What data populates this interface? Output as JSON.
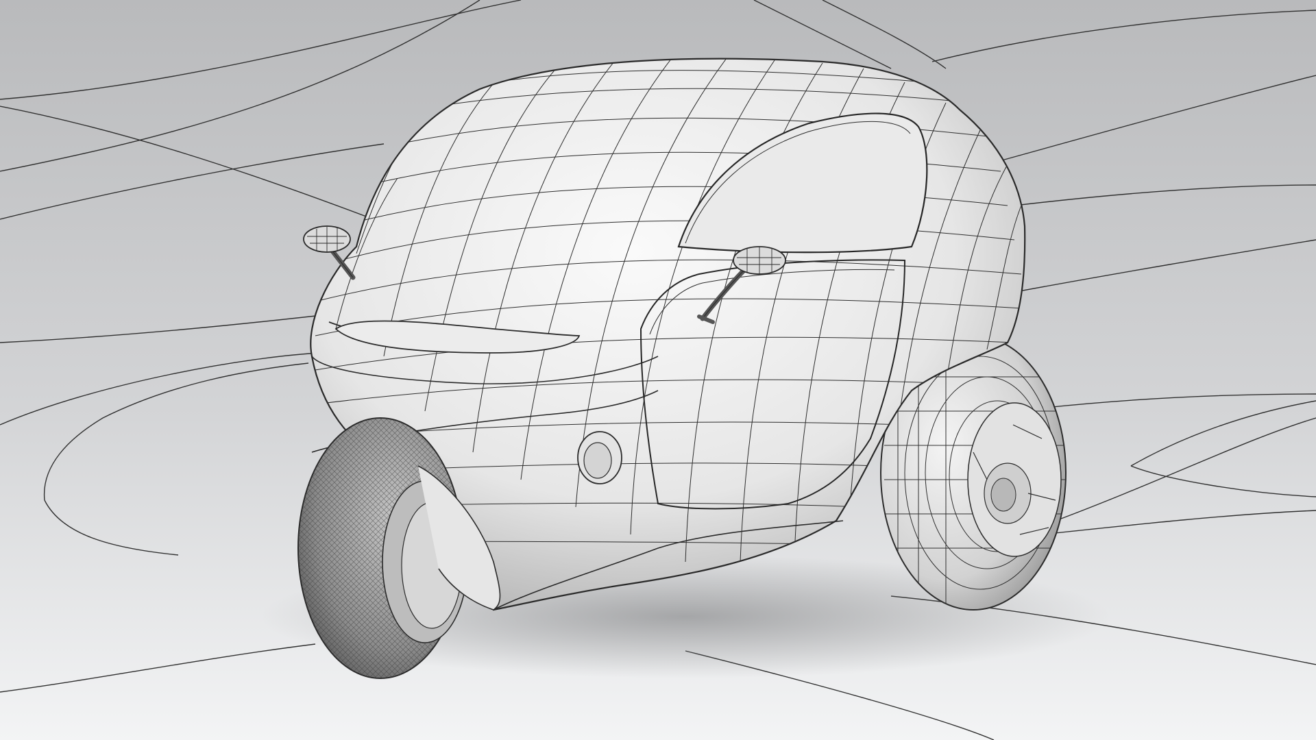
{
  "scene": {
    "subject": "three-wheeled-vehicle-wireframe",
    "colors": {
      "background_top": "#bcbdbf",
      "background_bottom": "#f2f3f4",
      "body_light": "#f6f6f6",
      "body_mid": "#d8d8d8",
      "body_shadow": "#9a9a9a",
      "wire": "#2c2c2c",
      "tire": "#7a7a7a"
    }
  }
}
